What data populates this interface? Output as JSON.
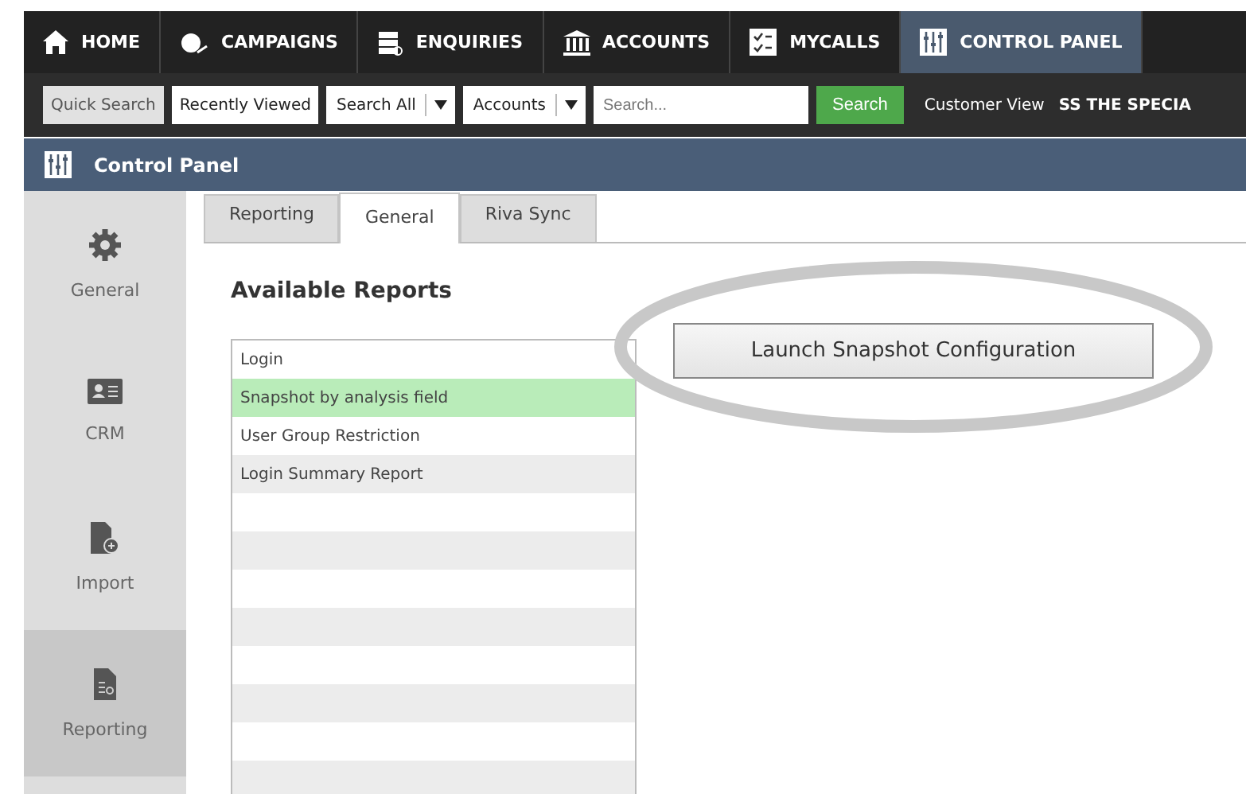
{
  "nav": [
    {
      "label": "HOME",
      "kind": "home",
      "selected": false
    },
    {
      "label": "CAMPAIGNS",
      "kind": "campaigns",
      "selected": false
    },
    {
      "label": "ENQUIRIES",
      "kind": "enquiries",
      "selected": false
    },
    {
      "label": "ACCOUNTS",
      "kind": "accounts",
      "selected": false
    },
    {
      "label": "MYCALLS",
      "kind": "mycalls",
      "selected": false
    },
    {
      "label": "CONTROL PANEL",
      "kind": "control",
      "selected": true
    }
  ],
  "toolbar": {
    "quick_search": "Quick Search",
    "recently_viewed": "Recently Viewed",
    "scope": "Search All",
    "module": "Accounts",
    "search": {
      "placeholder": "Search..."
    },
    "search_button": "Search",
    "customer_view": "Customer View",
    "marquee": "SS THE SPECIA"
  },
  "page_title": "Control Panel",
  "sidebar": [
    {
      "label": "General",
      "kind": "gear",
      "selected": false
    },
    {
      "label": "CRM",
      "kind": "card",
      "selected": false
    },
    {
      "label": "Import",
      "kind": "import",
      "selected": false
    },
    {
      "label": "Reporting",
      "kind": "report",
      "selected": true
    }
  ],
  "tabs": [
    {
      "label": "Reporting",
      "selected": false
    },
    {
      "label": "General",
      "selected": true
    },
    {
      "label": "Riva Sync",
      "selected": false
    }
  ],
  "section_title": "Available Reports",
  "reports": [
    {
      "label": "Login",
      "selected": false
    },
    {
      "label": "Snapshot by analysis field",
      "selected": true
    },
    {
      "label": "User Group Restriction",
      "selected": false
    },
    {
      "label": "Login Summary Report",
      "selected": false
    }
  ],
  "launch_button": "Launch Snapshot Configuration"
}
